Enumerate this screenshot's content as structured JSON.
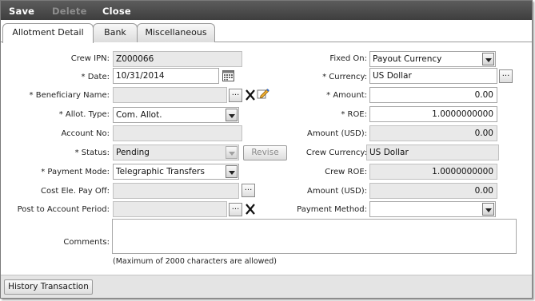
{
  "toolbar": {
    "save": "Save",
    "delete": "Delete",
    "close": "Close"
  },
  "tabs": [
    "Allotment Detail",
    "Bank",
    "Miscellaneous"
  ],
  "left": {
    "crew_ipn": {
      "label": "Crew IPN:",
      "value": "Z000066"
    },
    "date": {
      "label": "* Date:",
      "value": "10/31/2014"
    },
    "beneficiary": {
      "label": "* Beneficiary Name:",
      "value": ""
    },
    "allot_type": {
      "label": "* Allot. Type:",
      "value": "Com. Allot."
    },
    "account_no": {
      "label": "Account No:",
      "value": ""
    },
    "status": {
      "label": "* Status:",
      "value": "Pending",
      "revise": "Revise"
    },
    "payment_mode": {
      "label": "* Payment Mode:",
      "value": "Telegraphic Transfers"
    },
    "cost_ele": {
      "label": "Cost Ele. Pay Off:",
      "value": ""
    },
    "post_period": {
      "label": "Post to Account Period:",
      "value": ""
    }
  },
  "right": {
    "fixed_on": {
      "label": "Fixed On:",
      "value": "Payout Currency"
    },
    "currency": {
      "label": "* Currency:",
      "value": "US Dollar"
    },
    "amount": {
      "label": "* Amount:",
      "value": "0.00"
    },
    "roe": {
      "label": "* ROE:",
      "value": "1.0000000000"
    },
    "amount_usd": {
      "label": "Amount (USD):",
      "value": "0.00"
    },
    "crew_currency": {
      "label": "Crew Currency:",
      "value": "US Dollar"
    },
    "crew_roe": {
      "label": "Crew ROE:",
      "value": "1.0000000000"
    },
    "amount_usd2": {
      "label": "Amount (USD):",
      "value": "0.00"
    },
    "payment_method": {
      "label": "Payment Method:",
      "value": ""
    }
  },
  "comments": {
    "label": "Comments:",
    "value": "",
    "hint": "(Maximum of 2000 characters are allowed)"
  },
  "footer": {
    "history_button": "History Transaction"
  },
  "icons": {
    "ellipsis": "...",
    "calendar": "calendar-icon",
    "clear": "clear-x-icon",
    "edit": "edit-pencil-icon",
    "dropdown": "chevron-down-icon"
  }
}
